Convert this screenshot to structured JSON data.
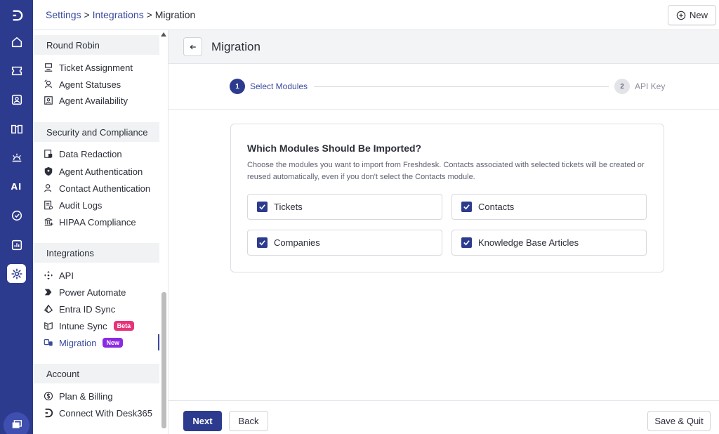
{
  "breadcrumb": {
    "settings": "Settings",
    "separator1": ">",
    "integrations": "Integrations",
    "separator2": ">",
    "current": "Migration"
  },
  "topbar": {
    "new_label": "New"
  },
  "rail": {
    "icons": [
      "brand-logo-icon",
      "home-icon",
      "tickets-icon",
      "contacts-icon",
      "knowledge-base-icon",
      "dashboard-icon",
      "ai-icon",
      "tasks-icon",
      "reports-icon",
      "settings-icon",
      "chat-icon"
    ],
    "ai_label": "AI",
    "accent": "#2d3b8e"
  },
  "nav": {
    "sections": [
      {
        "title": "Round Robin",
        "items": [
          {
            "label": "Ticket Assignment"
          },
          {
            "label": "Agent Statuses"
          },
          {
            "label": "Agent Availability"
          }
        ]
      },
      {
        "title": "Security and Compliance",
        "items": [
          {
            "label": "Data Redaction"
          },
          {
            "label": "Agent Authentication"
          },
          {
            "label": "Contact Authentication"
          },
          {
            "label": "Audit Logs"
          },
          {
            "label": "HIPAA Compliance"
          }
        ]
      },
      {
        "title": "Integrations",
        "items": [
          {
            "label": "API"
          },
          {
            "label": "Power Automate"
          },
          {
            "label": "Entra ID Sync"
          },
          {
            "label": "Intune Sync",
            "badge": "Beta"
          },
          {
            "label": "Migration",
            "badge": "New",
            "active": true
          }
        ]
      },
      {
        "title": "Account",
        "items": [
          {
            "label": "Plan & Billing"
          },
          {
            "label": "Connect With Desk365"
          }
        ]
      }
    ]
  },
  "page": {
    "title": "Migration",
    "steps": [
      {
        "number": "1",
        "label": "Select Modules",
        "active": true
      },
      {
        "number": "2",
        "label": "API Key",
        "active": false
      }
    ],
    "card": {
      "title": "Which Modules Should Be Imported?",
      "description": "Choose the modules you want to import from Freshdesk. Contacts associated with selected tickets will be created or reused automatically, even if you don't select the Contacts module.",
      "options": [
        {
          "label": "Tickets",
          "checked": true
        },
        {
          "label": "Contacts",
          "checked": true
        },
        {
          "label": "Companies",
          "checked": true
        },
        {
          "label": "Knowledge Base Articles",
          "checked": true
        }
      ]
    }
  },
  "footer": {
    "next_label": "Next",
    "back_label": "Back",
    "save_quit_label": "Save & Quit"
  },
  "colors": {
    "primary": "#2d3b8e",
    "link": "#3a4a9e",
    "beta_badge": "#e8337a",
    "new_badge": "#8a2be2"
  }
}
